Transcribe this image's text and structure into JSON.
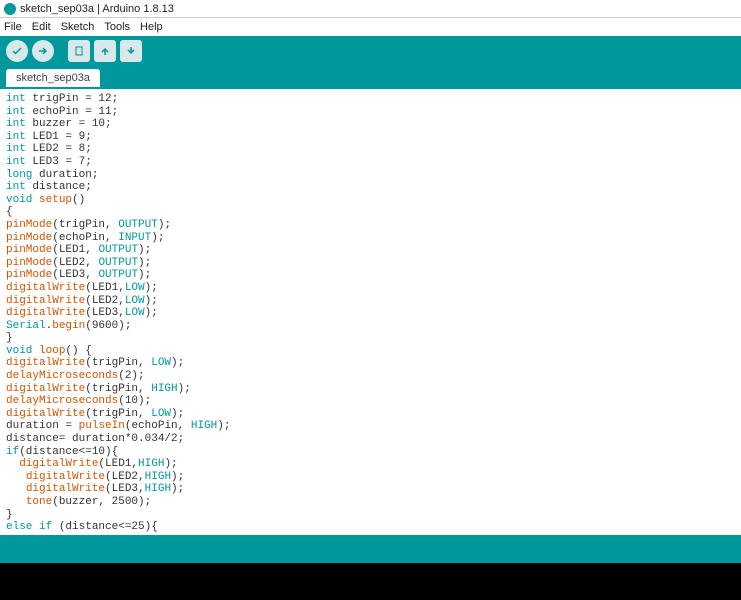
{
  "title": "sketch_sep03a | Arduino 1.8.13",
  "menu": {
    "file": "File",
    "edit": "Edit",
    "sketch": "Sketch",
    "tools": "Tools",
    "help": "Help"
  },
  "tabs": [
    {
      "label": "sketch_sep03a"
    }
  ],
  "toolbar": {
    "verify": "Verify",
    "upload": "Upload",
    "new": "New",
    "open": "Open",
    "save": "Save"
  },
  "code": [
    [
      {
        "t": "kw-type",
        "v": "int"
      },
      {
        "t": "plain",
        "v": " trigPin = 12;"
      }
    ],
    [
      {
        "t": "kw-type",
        "v": "int"
      },
      {
        "t": "plain",
        "v": " echoPin = 11;"
      }
    ],
    [
      {
        "t": "kw-type",
        "v": "int"
      },
      {
        "t": "plain",
        "v": " buzzer = 10;"
      }
    ],
    [
      {
        "t": "kw-type",
        "v": "int"
      },
      {
        "t": "plain",
        "v": " LED1 = 9;"
      }
    ],
    [
      {
        "t": "kw-type",
        "v": "int"
      },
      {
        "t": "plain",
        "v": " LED2 = 8;"
      }
    ],
    [
      {
        "t": "kw-type",
        "v": "int"
      },
      {
        "t": "plain",
        "v": " LED3 = 7;"
      }
    ],
    [
      {
        "t": "kw-type",
        "v": "long"
      },
      {
        "t": "plain",
        "v": " duration;"
      }
    ],
    [
      {
        "t": "kw-type",
        "v": "int"
      },
      {
        "t": "plain",
        "v": " distance;"
      }
    ],
    [
      {
        "t": "kw-type",
        "v": "void"
      },
      {
        "t": "plain",
        "v": " "
      },
      {
        "t": "kw-fn",
        "v": "setup"
      },
      {
        "t": "plain",
        "v": "()"
      }
    ],
    [
      {
        "t": "plain",
        "v": "{"
      }
    ],
    [
      {
        "t": "kw-fn",
        "v": "pinMode"
      },
      {
        "t": "plain",
        "v": "(trigPin, "
      },
      {
        "t": "kw-const",
        "v": "OUTPUT"
      },
      {
        "t": "plain",
        "v": ");"
      }
    ],
    [
      {
        "t": "kw-fn",
        "v": "pinMode"
      },
      {
        "t": "plain",
        "v": "(echoPin, "
      },
      {
        "t": "kw-const",
        "v": "INPUT"
      },
      {
        "t": "plain",
        "v": ");"
      }
    ],
    [
      {
        "t": "kw-fn",
        "v": "pinMode"
      },
      {
        "t": "plain",
        "v": "(LED1, "
      },
      {
        "t": "kw-const",
        "v": "OUTPUT"
      },
      {
        "t": "plain",
        "v": ");"
      }
    ],
    [
      {
        "t": "kw-fn",
        "v": "pinMode"
      },
      {
        "t": "plain",
        "v": "(LED2, "
      },
      {
        "t": "kw-const",
        "v": "OUTPUT"
      },
      {
        "t": "plain",
        "v": ");"
      }
    ],
    [
      {
        "t": "kw-fn",
        "v": "pinMode"
      },
      {
        "t": "plain",
        "v": "(LED3, "
      },
      {
        "t": "kw-const",
        "v": "OUTPUT"
      },
      {
        "t": "plain",
        "v": ");"
      }
    ],
    [
      {
        "t": "kw-fn",
        "v": "digitalWrite"
      },
      {
        "t": "plain",
        "v": "(LED1,"
      },
      {
        "t": "kw-const",
        "v": "LOW"
      },
      {
        "t": "plain",
        "v": ");"
      }
    ],
    [
      {
        "t": "kw-fn",
        "v": "digitalWrite"
      },
      {
        "t": "plain",
        "v": "(LED2,"
      },
      {
        "t": "kw-const",
        "v": "LOW"
      },
      {
        "t": "plain",
        "v": ");"
      }
    ],
    [
      {
        "t": "kw-fn",
        "v": "digitalWrite"
      },
      {
        "t": "plain",
        "v": "(LED3,"
      },
      {
        "t": "kw-const",
        "v": "LOW"
      },
      {
        "t": "plain",
        "v": ");"
      }
    ],
    [
      {
        "t": "kw-const",
        "v": "Serial"
      },
      {
        "t": "plain",
        "v": "."
      },
      {
        "t": "kw-fn",
        "v": "begin"
      },
      {
        "t": "plain",
        "v": "(9600);"
      }
    ],
    [
      {
        "t": "plain",
        "v": "}"
      }
    ],
    [
      {
        "t": "kw-type",
        "v": "void"
      },
      {
        "t": "plain",
        "v": " "
      },
      {
        "t": "kw-fn",
        "v": "loop"
      },
      {
        "t": "plain",
        "v": "() {"
      }
    ],
    [
      {
        "t": "kw-fn",
        "v": "digitalWrite"
      },
      {
        "t": "plain",
        "v": "(trigPin, "
      },
      {
        "t": "kw-const",
        "v": "LOW"
      },
      {
        "t": "plain",
        "v": ");"
      }
    ],
    [
      {
        "t": "kw-fn",
        "v": "delayMicroseconds"
      },
      {
        "t": "plain",
        "v": "(2);"
      }
    ],
    [
      {
        "t": "kw-fn",
        "v": "digitalWrite"
      },
      {
        "t": "plain",
        "v": "(trigPin, "
      },
      {
        "t": "kw-const",
        "v": "HIGH"
      },
      {
        "t": "plain",
        "v": ");"
      }
    ],
    [
      {
        "t": "kw-fn",
        "v": "delayMicroseconds"
      },
      {
        "t": "plain",
        "v": "(10);"
      }
    ],
    [
      {
        "t": "kw-fn",
        "v": "digitalWrite"
      },
      {
        "t": "plain",
        "v": "(trigPin, "
      },
      {
        "t": "kw-const",
        "v": "LOW"
      },
      {
        "t": "plain",
        "v": ");"
      }
    ],
    [
      {
        "t": "plain",
        "v": "duration = "
      },
      {
        "t": "kw-fn",
        "v": "pulseIn"
      },
      {
        "t": "plain",
        "v": "(echoPin, "
      },
      {
        "t": "kw-const",
        "v": "HIGH"
      },
      {
        "t": "plain",
        "v": ");"
      }
    ],
    [
      {
        "t": "plain",
        "v": "distance= duration*0.034/2;"
      }
    ],
    [
      {
        "t": "kw-type",
        "v": "if"
      },
      {
        "t": "plain",
        "v": "(distance<=10){"
      }
    ],
    [
      {
        "t": "plain",
        "v": "  "
      },
      {
        "t": "kw-fn",
        "v": "digitalWrite"
      },
      {
        "t": "plain",
        "v": "(LED1,"
      },
      {
        "t": "kw-const",
        "v": "HIGH"
      },
      {
        "t": "plain",
        "v": ");"
      }
    ],
    [
      {
        "t": "plain",
        "v": "   "
      },
      {
        "t": "kw-fn",
        "v": "digitalWrite"
      },
      {
        "t": "plain",
        "v": "(LED2,"
      },
      {
        "t": "kw-const",
        "v": "HIGH"
      },
      {
        "t": "plain",
        "v": ");"
      }
    ],
    [
      {
        "t": "plain",
        "v": "   "
      },
      {
        "t": "kw-fn",
        "v": "digitalWrite"
      },
      {
        "t": "plain",
        "v": "(LED3,"
      },
      {
        "t": "kw-const",
        "v": "HIGH"
      },
      {
        "t": "plain",
        "v": ");"
      }
    ],
    [
      {
        "t": "plain",
        "v": "   "
      },
      {
        "t": "kw-fn",
        "v": "tone"
      },
      {
        "t": "plain",
        "v": "(buzzer, 2500);"
      }
    ],
    [
      {
        "t": "plain",
        "v": "}"
      }
    ],
    [
      {
        "t": "kw-type",
        "v": "else if"
      },
      {
        "t": "plain",
        "v": " (distance<=25){"
      }
    ]
  ]
}
